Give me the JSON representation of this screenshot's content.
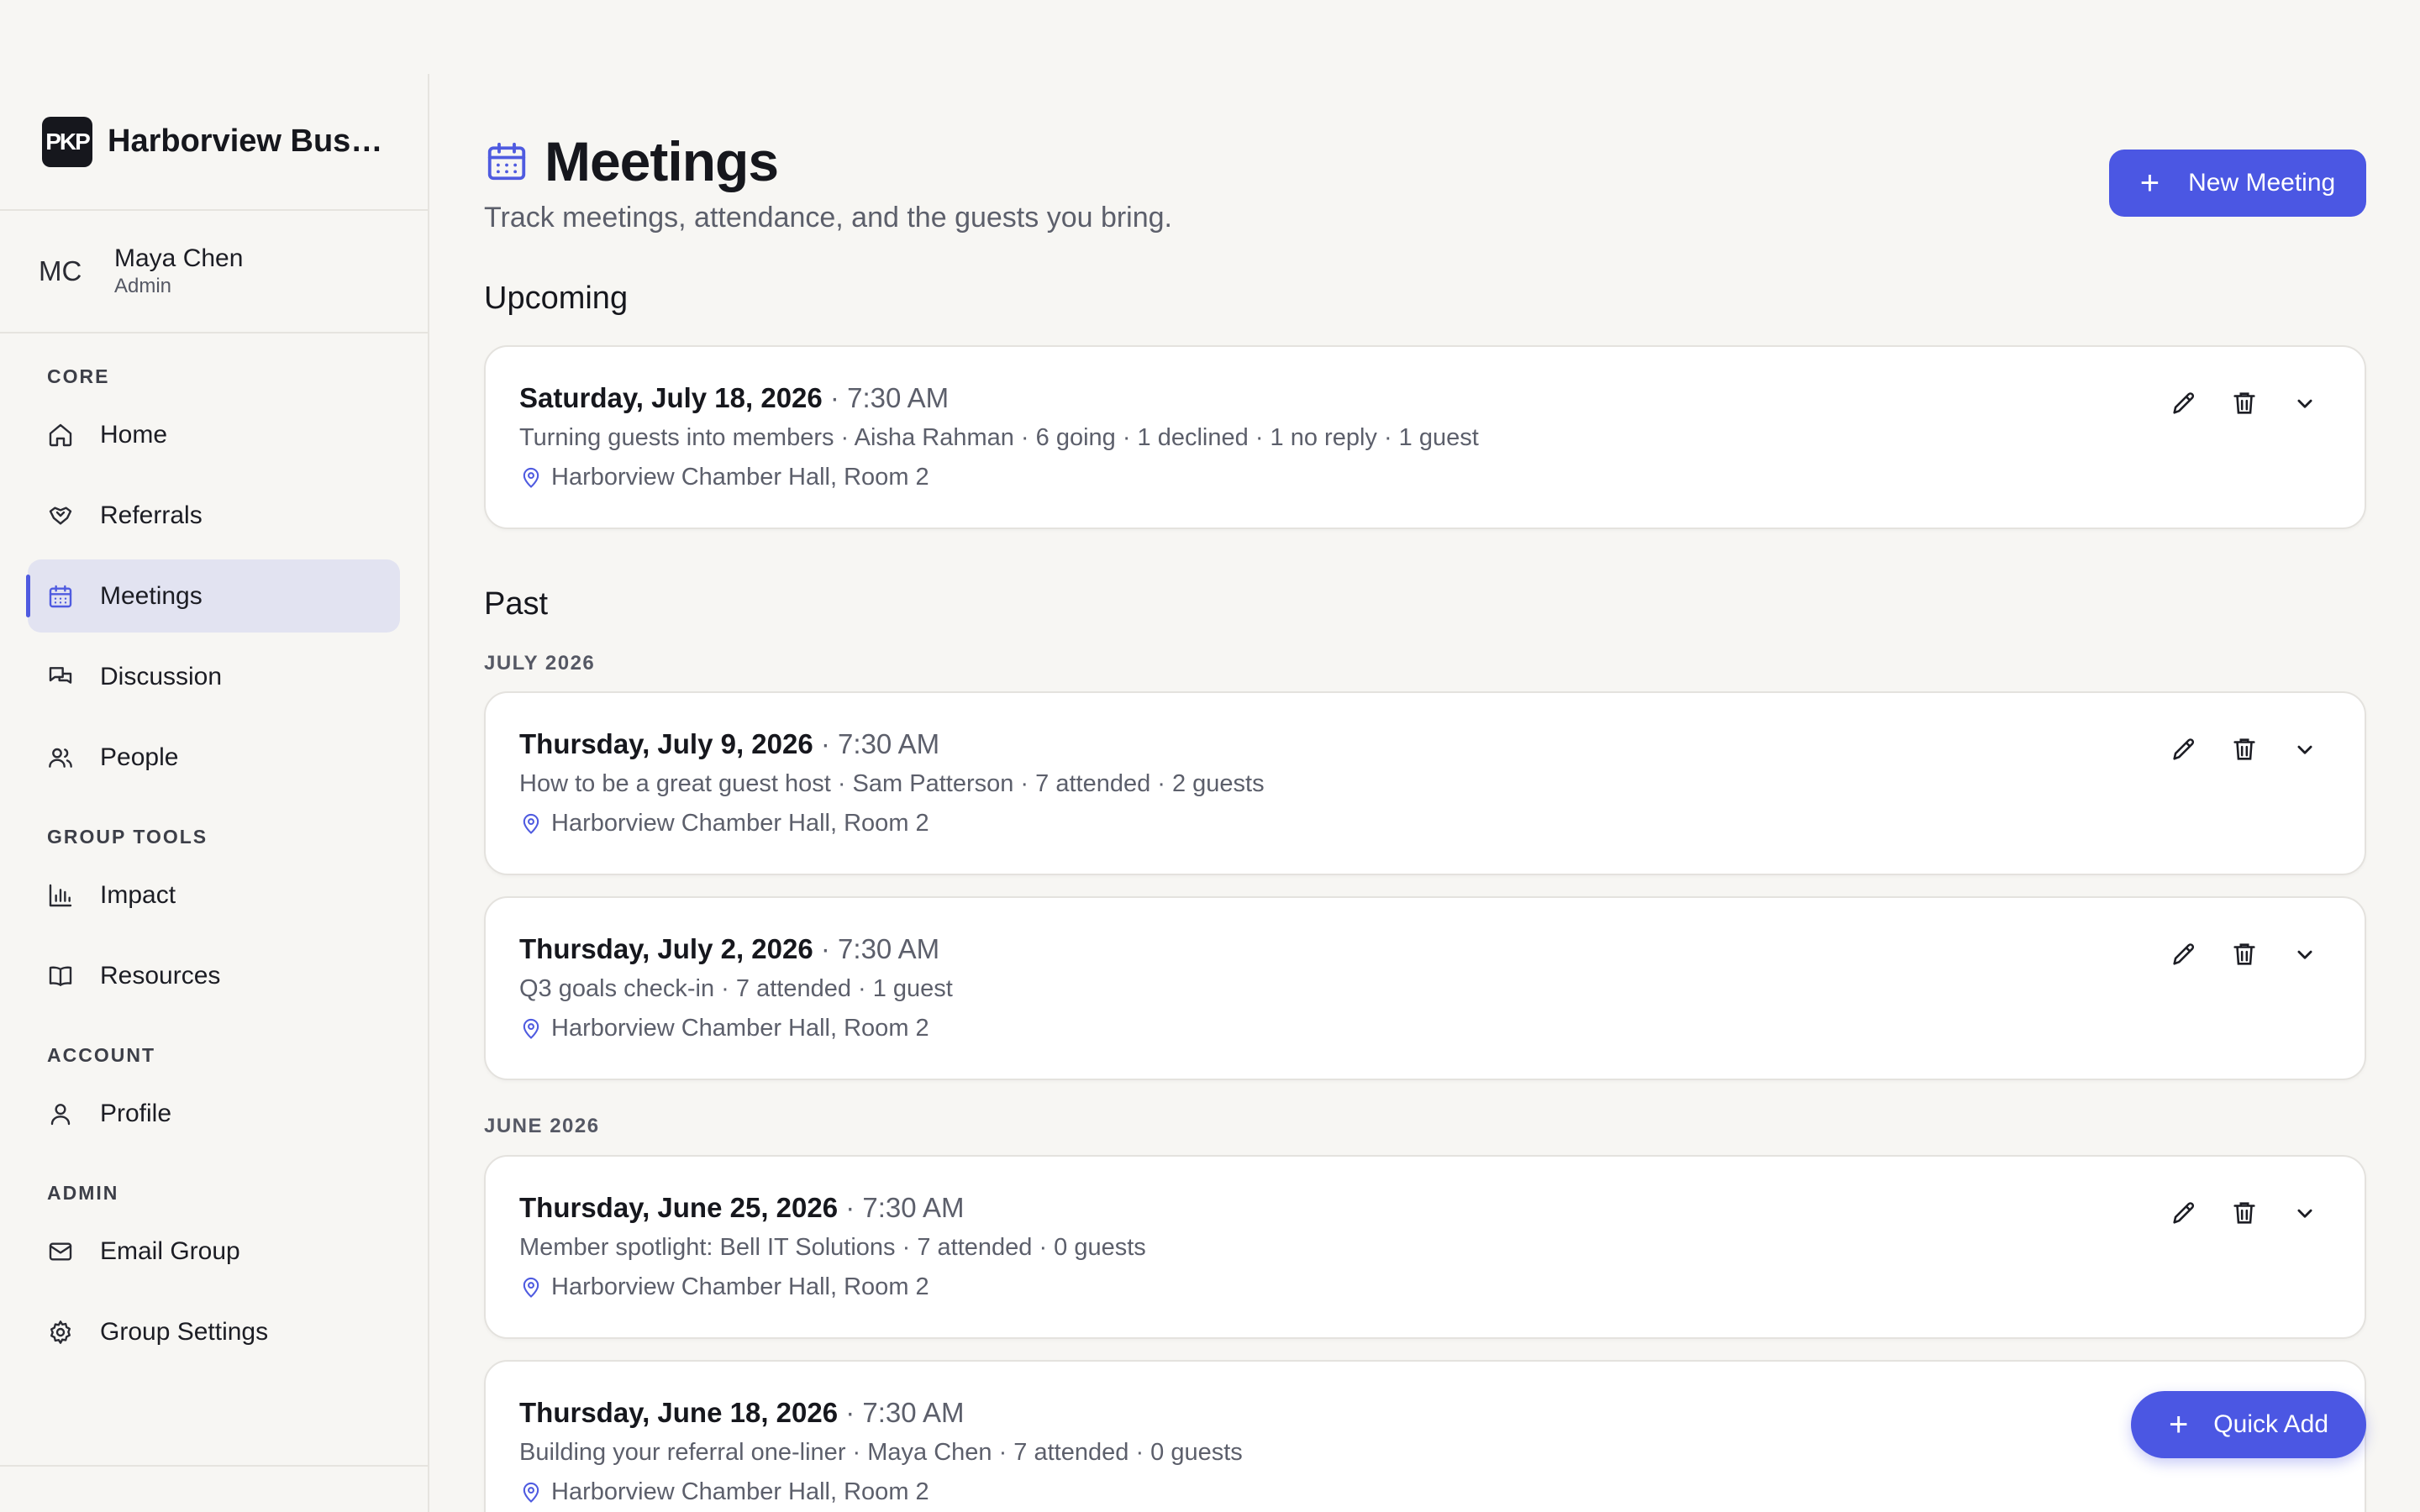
{
  "brand": {
    "name": "Harborview Business Network",
    "logo_text": "PKP"
  },
  "user": {
    "initials": "MC",
    "name": "Maya Chen",
    "role": "Admin"
  },
  "nav": {
    "core_label": "CORE",
    "home": "Home",
    "referrals": "Referrals",
    "meetings": "Meetings",
    "discussion": "Discussion",
    "people": "People",
    "group_tools_label": "GROUP TOOLS",
    "impact": "Impact",
    "resources": "Resources",
    "account_label": "ACCOUNT",
    "profile": "Profile",
    "admin_label": "ADMIN",
    "email_group": "Email Group",
    "group_settings": "Group Settings"
  },
  "header": {
    "title": "Meetings",
    "subtitle": "Track meetings, attendance, and the guests you bring.",
    "new_button": "New Meeting"
  },
  "upcoming": {
    "title": "Upcoming",
    "meetings": [
      {
        "date": "Saturday, July 18, 2026",
        "time": " · 7:30 AM",
        "details": "Turning guests into members · Aisha Rahman · 6 going · 1 declined · 1 no reply · 1 guest",
        "location": "Harborview Chamber Hall, Room 2"
      }
    ]
  },
  "past": {
    "title": "Past",
    "months": [
      {
        "label": "JULY 2026",
        "meetings": [
          {
            "date": "Thursday, July 9, 2026",
            "time": " · 7:30 AM",
            "details": "How to be a great guest host · Sam Patterson · 7 attended · 2 guests",
            "location": "Harborview Chamber Hall, Room 2"
          },
          {
            "date": "Thursday, July 2, 2026",
            "time": " · 7:30 AM",
            "details": "Q3 goals check-in · 7 attended · 1 guest",
            "location": "Harborview Chamber Hall, Room 2"
          }
        ]
      },
      {
        "label": "JUNE 2026",
        "meetings": [
          {
            "date": "Thursday, June 25, 2026",
            "time": " · 7:30 AM",
            "details": "Member spotlight: Bell IT Solutions · 7 attended · 0 guests",
            "location": "Harborview Chamber Hall, Room 2"
          },
          {
            "date": "Thursday, June 18, 2026",
            "time": " · 7:30 AM",
            "details": "Building your referral one-liner · Maya Chen · 7 attended · 0 guests",
            "location": "Harborview Chamber Hall, Room 2"
          }
        ]
      }
    ]
  },
  "quick_add": "Quick Add",
  "colors": {
    "accent": "#4b57e3",
    "active_nav_bg": "#e2e3f1",
    "page_bg": "#f7f6f3"
  }
}
